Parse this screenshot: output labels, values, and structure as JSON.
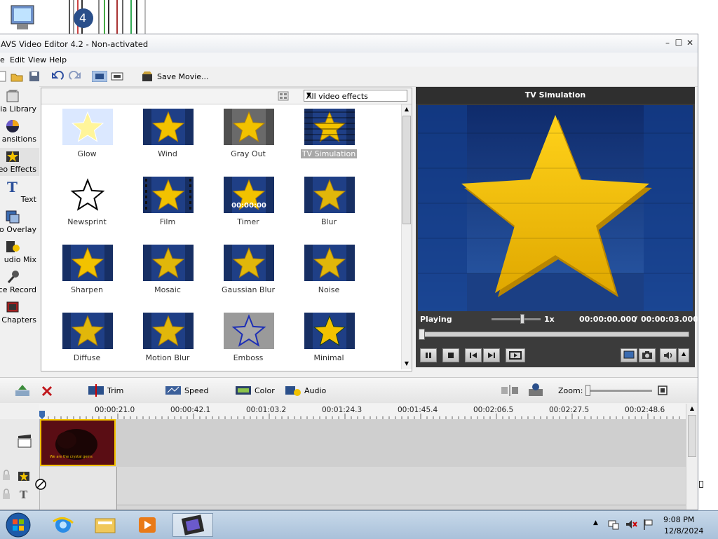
{
  "window": {
    "title": "AVS Video Editor 4.2 - Non-activated",
    "minimize_icon": "minimize-icon",
    "maximize_icon": "maximize-icon",
    "close_icon": "close-icon"
  },
  "menu": [
    {
      "label": "e"
    },
    {
      "label": "Edit"
    },
    {
      "label": "View"
    },
    {
      "label": "Help"
    }
  ],
  "toolbar": {
    "save_movie_label": "Save Movie..."
  },
  "sidebar": {
    "items": [
      {
        "label": "dia Library",
        "icon": "media-library-icon"
      },
      {
        "label": "ansitions",
        "icon": "transitions-icon"
      },
      {
        "label": "deo Effects",
        "icon": "video-effects-icon"
      },
      {
        "label": "Text",
        "icon": "text-icon"
      },
      {
        "label": "eo Overlay",
        "icon": "video-overlay-icon"
      },
      {
        "label": "udio Mix",
        "icon": "audio-mix-icon"
      },
      {
        "label": "ice Record",
        "icon": "voice-record-icon"
      },
      {
        "label": "Chapters",
        "icon": "chapters-icon"
      }
    ]
  },
  "effects": {
    "filter_selected": "All video effects",
    "items": [
      {
        "name": "Glow"
      },
      {
        "name": "Wind"
      },
      {
        "name": "Gray Out"
      },
      {
        "name": "TV Simulation",
        "selected": true
      },
      {
        "name": "Newsprint"
      },
      {
        "name": "Film"
      },
      {
        "name": "Timer",
        "overlay": "00:00:00"
      },
      {
        "name": "Blur"
      },
      {
        "name": "Sharpen"
      },
      {
        "name": "Mosaic"
      },
      {
        "name": "Gaussian Blur"
      },
      {
        "name": "Noise"
      },
      {
        "name": "Diffuse"
      },
      {
        "name": "Motion Blur"
      },
      {
        "name": "Emboss"
      },
      {
        "name": "Minimal"
      }
    ]
  },
  "preview": {
    "title": "TV Simulation",
    "status": "Playing",
    "speed": "1x",
    "current_time": "00:00:00.000",
    "separator": "/",
    "total_time": "00:00:03.000"
  },
  "timeline_toolbar": {
    "trim_label": "Trim",
    "speed_label": "Speed",
    "color_label": "Color",
    "audio_label": "Audio",
    "zoom_label": "Zoom:"
  },
  "timeline": {
    "ticks": [
      "00:00:21.0",
      "00:00:42.1",
      "00:01:03.2",
      "00:01:24.3",
      "00:01:45.4",
      "00:02:06.5",
      "00:02:27.5",
      "00:02:48.6"
    ],
    "clip_caption": "We are the crystal gems"
  },
  "taskbar": {
    "time": "9:08 PM",
    "date": "12/8/2024"
  },
  "colors": {
    "preview_bg": "#1f3f86",
    "star": "#f2c200",
    "window_bg": "#f0f0f0"
  }
}
